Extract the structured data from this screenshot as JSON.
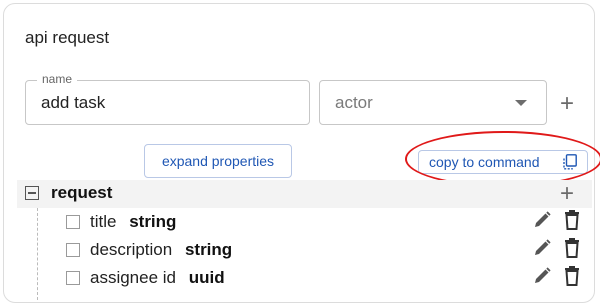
{
  "card": {
    "title": "api request",
    "name_field": {
      "label": "name",
      "value": "add task"
    },
    "actor_field": {
      "placeholder": "actor"
    }
  },
  "actions": {
    "expand_label": "expand properties",
    "copy_label": "copy to command"
  },
  "request": {
    "label": "request",
    "properties": [
      {
        "name": "title",
        "type": "string"
      },
      {
        "name": "description",
        "type": "string"
      },
      {
        "name": "assignee id",
        "type": "uuid"
      }
    ]
  },
  "icons": {
    "add": "plus-icon",
    "collapse": "minus-box-icon",
    "copy": "copy-icon",
    "edit": "pencil-icon",
    "delete": "trash-icon",
    "dropdown": "chevron-down-icon"
  },
  "colors": {
    "accent": "#1f57b4",
    "highlight": "#e01919"
  }
}
